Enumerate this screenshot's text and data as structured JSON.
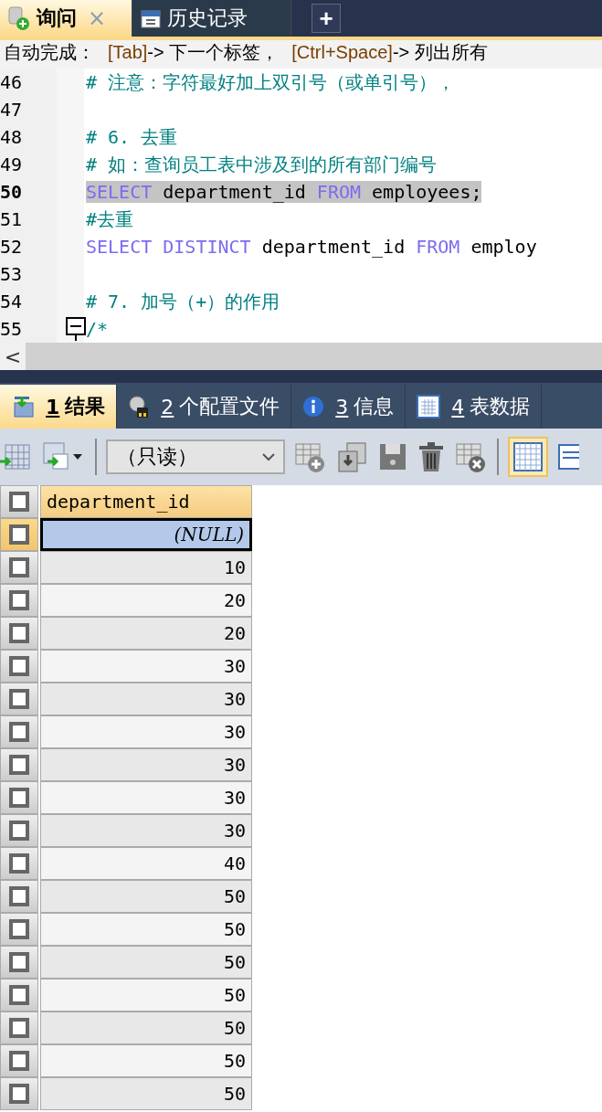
{
  "query_tabs": [
    {
      "label": "询问",
      "selected": true,
      "close": "×"
    },
    {
      "label": "历史记录",
      "selected": false
    }
  ],
  "add_tab": "+",
  "hint_bar": [
    {
      "kind": "plain",
      "text": "自动完成："
    },
    {
      "kind": "key",
      "text": "[Tab]"
    },
    {
      "kind": "plain",
      "text": "-> 下一个标签，"
    },
    {
      "kind": "key",
      "text": "[Ctrl+Space]"
    },
    {
      "kind": "plain",
      "text": "-> 列出所有"
    }
  ],
  "editor_lines": [
    {
      "number": "46",
      "highlighted": false,
      "fold": false,
      "tokens": [
        {
          "kind": "comment",
          "text": "# 注意：字符最好加上双引号（或单引号），"
        }
      ]
    },
    {
      "number": "47",
      "highlighted": false,
      "fold": false
    },
    {
      "number": "48",
      "highlighted": false,
      "fold": false,
      "tokens": [
        {
          "kind": "comment",
          "text": "# 6. 去重"
        }
      ]
    },
    {
      "number": "49",
      "highlighted": false,
      "fold": false,
      "tokens": [
        {
          "kind": "comment",
          "text": "# 如：查询员工表中涉及到的所有部门编号"
        }
      ]
    },
    {
      "number": "50",
      "highlighted": true,
      "fold": false,
      "tokens": [
        {
          "kind": "keyword",
          "text": "SELECT"
        },
        {
          "kind": "plain",
          "text": "department_id"
        },
        {
          "kind": "keyword",
          "text": "FROM"
        },
        {
          "kind": "plain",
          "text": "employees;"
        }
      ]
    },
    {
      "number": "51",
      "highlighted": false,
      "fold": false,
      "tokens": [
        {
          "kind": "comment",
          "text": "#去重"
        }
      ]
    },
    {
      "number": "52",
      "highlighted": false,
      "fold": false,
      "tokens": [
        {
          "kind": "keyword",
          "text": "SELECT"
        },
        {
          "kind": "keyword",
          "text": "DISTINCT"
        },
        {
          "kind": "plain",
          "text": "department_id"
        },
        {
          "kind": "keyword",
          "text": "FROM"
        },
        {
          "kind": "plain",
          "text": "employ"
        }
      ]
    },
    {
      "number": "53",
      "highlighted": false,
      "fold": false
    },
    {
      "number": "54",
      "highlighted": false,
      "fold": false,
      "tokens": [
        {
          "kind": "comment",
          "text": "# 7. 加号（+）的作用"
        }
      ]
    },
    {
      "number": "55",
      "highlighted": false,
      "fold": true,
      "tokens": [
        {
          "kind": "comment",
          "text": "/*"
        }
      ]
    }
  ],
  "scroll_left": "<",
  "result_tabs": [
    {
      "number": "1",
      "label": "结果",
      "selected": true,
      "kind": "results"
    },
    {
      "number": "2",
      "label": "个配置文件",
      "selected": false,
      "kind": "profiles"
    },
    {
      "number": "3",
      "label": "信息",
      "selected": false,
      "kind": "info"
    },
    {
      "number": "4",
      "label": "表数据",
      "selected": false,
      "kind": "tabledata"
    }
  ],
  "mode_dropdown": {
    "value": "（只读）"
  },
  "grid": {
    "column": "department_id",
    "header_checked": false,
    "rows": [
      {
        "value": "(NULL)",
        "null": true,
        "selected": true
      },
      {
        "value": "10",
        "null": false,
        "selected": false
      },
      {
        "value": "20",
        "null": false,
        "selected": false
      },
      {
        "value": "20",
        "null": false,
        "selected": false
      },
      {
        "value": "30",
        "null": false,
        "selected": false
      },
      {
        "value": "30",
        "null": false,
        "selected": false
      },
      {
        "value": "30",
        "null": false,
        "selected": false
      },
      {
        "value": "30",
        "null": false,
        "selected": false
      },
      {
        "value": "30",
        "null": false,
        "selected": false
      },
      {
        "value": "30",
        "null": false,
        "selected": false
      },
      {
        "value": "40",
        "null": false,
        "selected": false
      },
      {
        "value": "50",
        "null": false,
        "selected": false
      },
      {
        "value": "50",
        "null": false,
        "selected": false
      },
      {
        "value": "50",
        "null": false,
        "selected": false
      },
      {
        "value": "50",
        "null": false,
        "selected": false
      },
      {
        "value": "50",
        "null": false,
        "selected": false
      },
      {
        "value": "50",
        "null": false,
        "selected": false
      },
      {
        "value": "50",
        "null": false,
        "selected": false
      }
    ]
  }
}
